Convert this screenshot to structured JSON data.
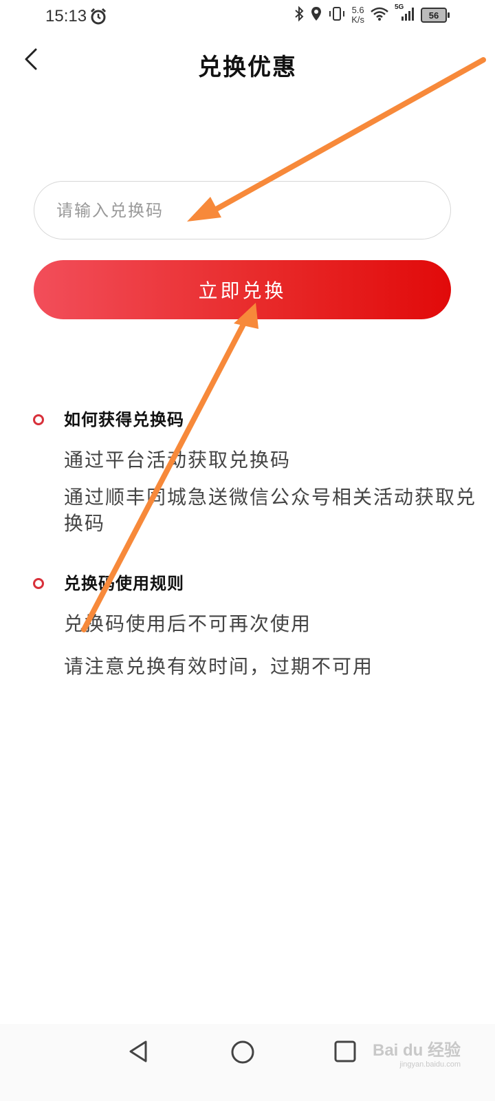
{
  "status_bar": {
    "time": "15:13",
    "net_speed_value": "5.6",
    "net_speed_unit": "K/s",
    "network_type": "5G",
    "battery": "56"
  },
  "header": {
    "title": "兑换优惠"
  },
  "redeem": {
    "placeholder": "请输入兑换码",
    "button_label": "立即兑换"
  },
  "sections": [
    {
      "heading": "如何获得兑换码",
      "lines": [
        "通过平台活动获取兑换码",
        "通过顺丰同城急送微信公众号相关活动获取兑换码"
      ]
    },
    {
      "heading": "兑换码使用规则",
      "lines": [
        "兑换码使用后不可再次使用",
        "请注意兑换有效时间，过期不可用"
      ]
    }
  ],
  "watermark": {
    "brand": "Bai du 经验",
    "url": "jingyan.baidu.com"
  },
  "colors": {
    "accent_red": "#e10a0a",
    "annotation_orange": "#f7893a"
  }
}
